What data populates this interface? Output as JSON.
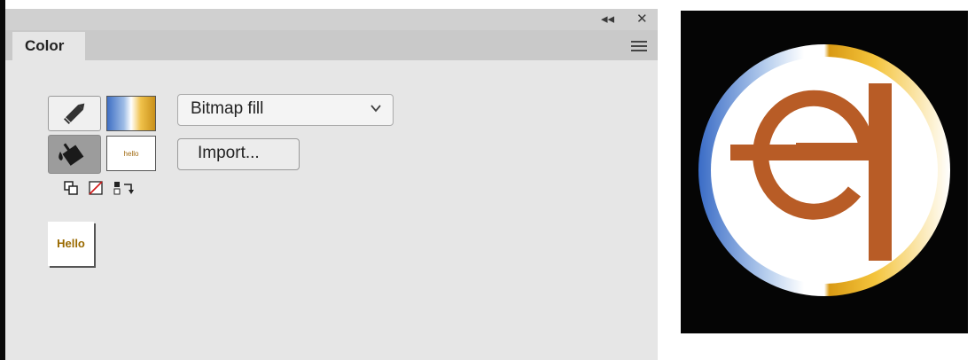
{
  "panel": {
    "tab_label": "Color",
    "fill_type": "Bitmap fill",
    "import_label": "Import...",
    "preview_text": "Hello",
    "bitmap_swatch_text": "hello"
  },
  "icons": {
    "collapse": "double-chevron-left-icon",
    "close": "close-icon",
    "menu": "panel-menu-icon",
    "stroke": "pencil-icon",
    "fill": "paint-bucket-icon",
    "black_white": "black-white-icon",
    "no_color": "no-color-icon",
    "swap": "swap-colors-icon"
  },
  "colors": {
    "panel_bg": "#e6e6e6",
    "gradient_blue": "#3f6fc4",
    "gradient_gold": "#e0a820",
    "logo_orange": "#b85c26",
    "logo_bg": "#050505"
  }
}
